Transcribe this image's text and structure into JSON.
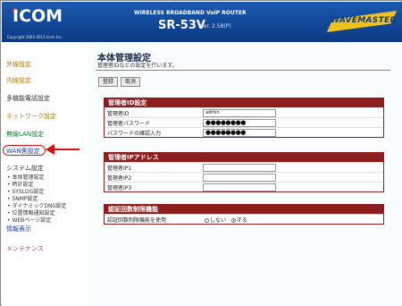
{
  "header": {
    "logo": "ICOM",
    "copyright": "Copyright 2002-2012 Icom Inc.",
    "product": "WIRELESS BROADBAND VoIP ROUTER",
    "model": "SR-53V",
    "version": "Ver. 2.58(P)",
    "brand": "WAVEMASTER"
  },
  "sidebar": {
    "items": [
      {
        "label": "外線設定"
      },
      {
        "label": "内線設定"
      },
      {
        "label": "多機能電話設定"
      },
      {
        "label": "ネットワーク設定"
      },
      {
        "label": "無線LAN設定"
      },
      {
        "label": "WAN側設定"
      },
      {
        "label": "システム設定"
      }
    ],
    "system_subitems": [
      "• 本体管理設定",
      "• 時計設定",
      "• SYSLOG設定",
      "• SNMP設定",
      "• ダイナミックDNS設定",
      "• 位置情報通知設定",
      "• WEBページ設定"
    ],
    "info": "情報表示",
    "maintenance": "メンテナンス"
  },
  "main": {
    "title": "本体管理設定",
    "description": "管理者IDなどの設定を行います。",
    "register_button": "登録",
    "cancel_button": "取消",
    "admin_section": {
      "title": "管理者ID設定",
      "rows": [
        {
          "label": "管理者ID",
          "value": "admin"
        },
        {
          "label": "管理者パスワード",
          "value": "●●●●●●●●"
        },
        {
          "label": "パスワードの確認入力",
          "value": "●●●●●●●●"
        }
      ]
    },
    "ip_section": {
      "title": "管理者IPアドレス",
      "rows": [
        {
          "label": "管理者IP1",
          "value": ""
        },
        {
          "label": "管理者IP2",
          "value": ""
        },
        {
          "label": "管理者IP3",
          "value": ""
        }
      ]
    },
    "auth_section": {
      "title": "認証回数制限機能",
      "label": "認証回数制限機能を使用",
      "option_off": "しない",
      "option_on": "する",
      "selected": "する"
    }
  },
  "colors": {
    "header": "#0f3f8a",
    "section_header": "#8c1e1e",
    "annotation": "#d41414"
  }
}
